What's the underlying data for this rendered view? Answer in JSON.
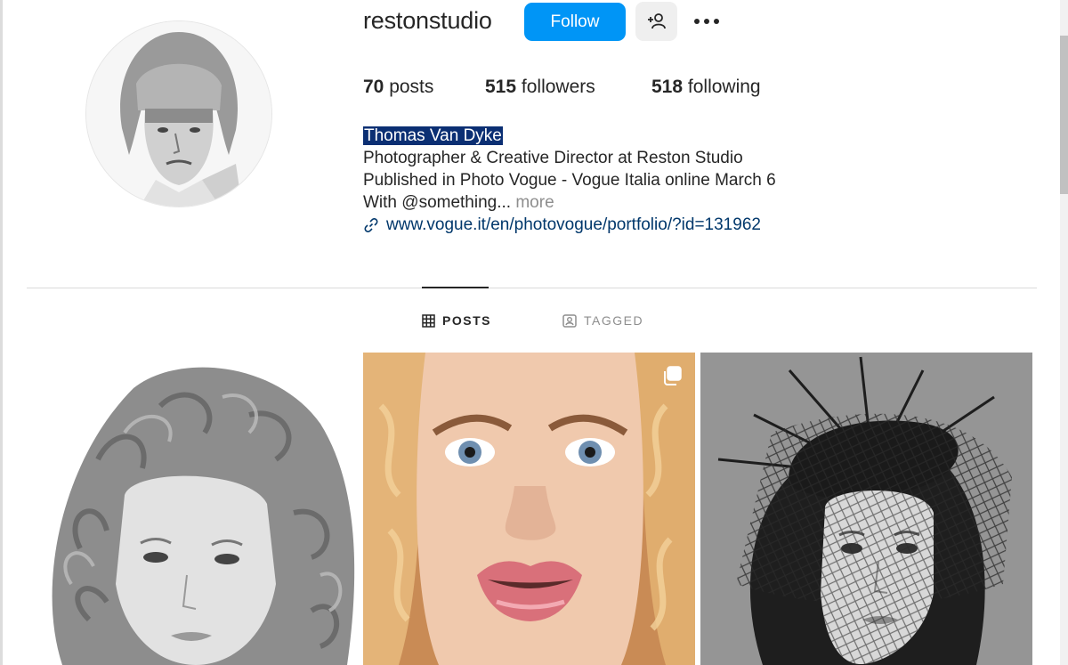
{
  "profile": {
    "username": "restonstudio",
    "follow_label": "Follow",
    "suggest_icon": "person-plus-icon",
    "more_icon": "more-horizontal-icon"
  },
  "stats": {
    "posts_count": "70",
    "posts_label": "posts",
    "followers_count": "515",
    "followers_label": "followers",
    "following_count": "518",
    "following_label": "following"
  },
  "bio": {
    "full_name": "Thomas Van Dyke",
    "line1": "Photographer & Creative Director at Reston Studio",
    "line2": "Published in Photo Vogue - Vogue Italia online March 6",
    "line3": "With @something...",
    "more_label": "more",
    "website": "www.vogue.it/en/photovogue/portfolio/?id=131962",
    "highlight_color": "#0b2f73"
  },
  "tabs": [
    {
      "label": "POSTS",
      "icon": "grid-icon",
      "active": true
    },
    {
      "label": "TAGGED",
      "icon": "tagged-person-icon",
      "active": false
    }
  ],
  "posts": [
    {
      "icon": ""
    },
    {
      "icon": "carousel-icon"
    },
    {
      "icon": ""
    }
  ],
  "colors": {
    "accent": "#0095f6",
    "link": "#00376b",
    "muted": "#8e8e8e"
  }
}
